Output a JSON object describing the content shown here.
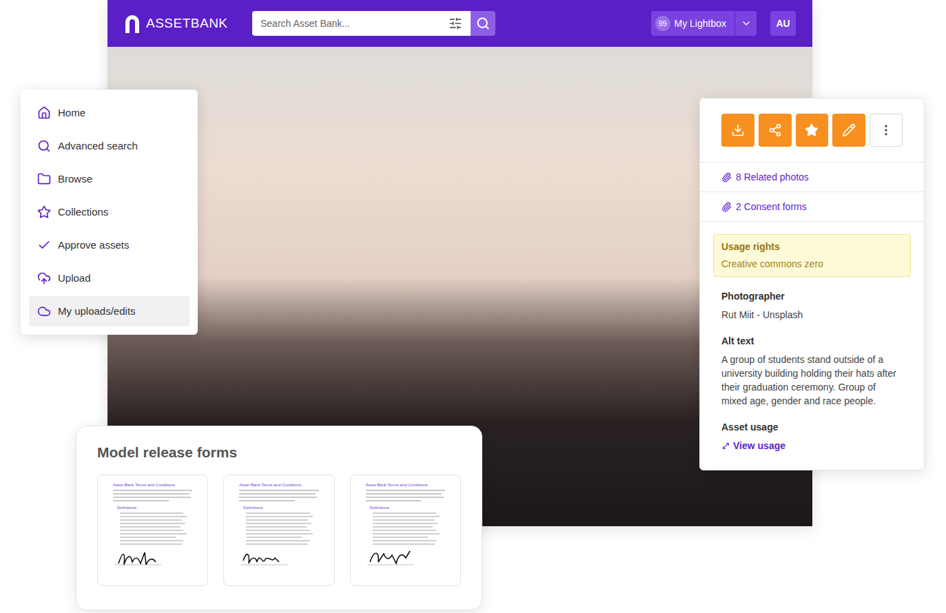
{
  "app": {
    "logo": "ASSETBANK",
    "search_placeholder": "Search Asset Bank...",
    "lightbox": {
      "count": "99",
      "label": "My Lightbox"
    },
    "user_initials": "AU"
  },
  "nav": {
    "items": [
      {
        "label": "Home",
        "selected": false
      },
      {
        "label": "Advanced search",
        "selected": false
      },
      {
        "label": "Browse",
        "selected": false
      },
      {
        "label": "Collections",
        "selected": false
      },
      {
        "label": "Approve assets",
        "selected": false
      },
      {
        "label": "Upload",
        "selected": false
      },
      {
        "label": "My uploads/edits",
        "selected": true
      }
    ]
  },
  "asset_panel": {
    "links": [
      {
        "label": "8 Related photos"
      },
      {
        "label": "2 Consent forms"
      }
    ],
    "usage_rights": {
      "label": "Usage rights",
      "value": "Creative commons zero"
    },
    "fields": [
      {
        "label": "Photographer",
        "value": "Rut Miit - Unsplash"
      },
      {
        "label": "Alt text",
        "value": "A group of students stand outside of a university building holding their hats after their graduation ceremony. Group of mixed age, gender and race people."
      }
    ],
    "asset_usage": {
      "label": "Asset usage",
      "link": "View usage"
    }
  },
  "release_forms": {
    "title": "Model release forms",
    "documents": [
      {
        "title": "Asset Bank Terms and Conditions",
        "section": "Definitions"
      },
      {
        "title": "Asset Bank Terms and Conditions",
        "section": "Definitions"
      },
      {
        "title": "Asset Bank Terms and Conditions",
        "section": "Definitions"
      }
    ]
  }
}
